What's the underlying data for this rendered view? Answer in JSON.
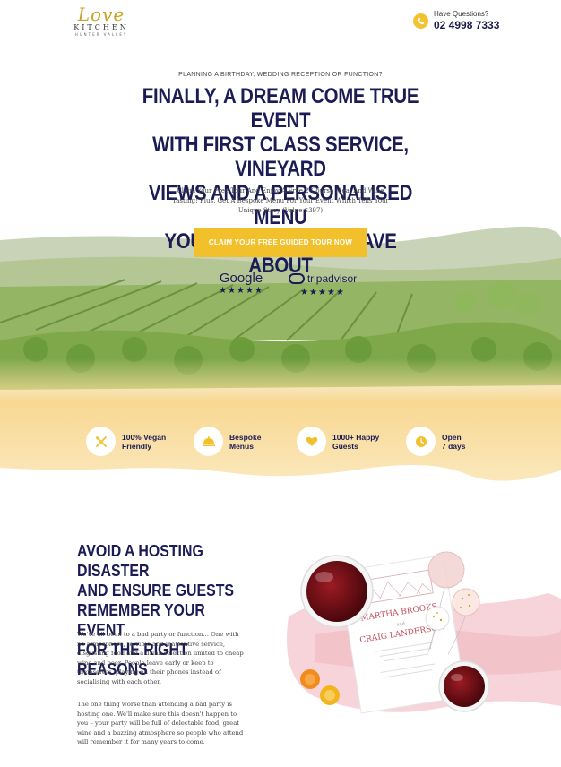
{
  "header": {
    "logo_script": "Love",
    "logo_main": "KITCHEN",
    "logo_sub": "HUNTER VALLEY",
    "question_label": "Have Questions?",
    "phone_number": "02 4998 7333"
  },
  "hero": {
    "pre_title": "PLANNING A BIRTHDAY, WEDDING RECEPTION OR FUNCTION?",
    "headline_lines": [
      "FINALLY, A DREAM COME TRUE EVENT",
      "WITH FIRST CLASS SERVICE, VINEYARD",
      "VIEWS AND A PERSONALISED MENU",
      "YOUR GUESTS WILL RAVE ABOUT"
    ],
    "sub_lines": [
      "Claim Your Free Tour And Enjoy A Free 2-Course Meal And Wine",
      "Tasting! Plus, Get A Bespoke Menu For Your Event Which Tells Your",
      "Unique Story (Value $397)"
    ],
    "cta_label": "CLAIM YOUR FREE GUIDED TOUR NOW",
    "ratings": [
      {
        "name": "Google",
        "stars": "★★★★★"
      },
      {
        "name": "tripadvisor",
        "stars": "★★★★★"
      }
    ]
  },
  "features": [
    {
      "icon": "vegan-icon",
      "line1": "100% Vegan",
      "line2": "Friendly"
    },
    {
      "icon": "cloche-icon",
      "line1": "Bespoke",
      "line2": "Menus"
    },
    {
      "icon": "heart-icon",
      "line1": "1000+ Happy",
      "line2": "Guests"
    },
    {
      "icon": "clock-icon",
      "line1": "Open",
      "line2": "7 days"
    }
  ],
  "section": {
    "title_lines": [
      "AVOID A HOSTING DISASTER",
      "AND ENSURE GUESTS",
      "REMEMBER YOUR EVENT",
      "FOR THE RIGHT REASONS"
    ],
    "para1_lines": [
      "We've all been to a bad party or function… One with",
      "no atmosphere, terrible and inattentive service,",
      "disgusting food and a drink selection limited to cheap",
      "wine and beer. People leave early or keep to",
      "themselves, playing on their phones instead of",
      "socialising with each other."
    ],
    "para2_lines": [
      "The one thing worse than attending a bad party is",
      "hosting one. We'll make sure this doesn't happen to",
      "you – your party will be full of delectable food, great",
      "wine and a buzzing atmosphere so people who attend",
      "will remember it for many years to come."
    ],
    "invite": {
      "name1": "MARTHA BROOKS",
      "and": "and",
      "name2": "CRAIG LANDERSON"
    }
  },
  "colors": {
    "accent": "#f2c02a",
    "navy": "#1b1b55",
    "watercolor_yellow": "#f6d38a",
    "watercolor_pink": "#f4c6cc"
  }
}
